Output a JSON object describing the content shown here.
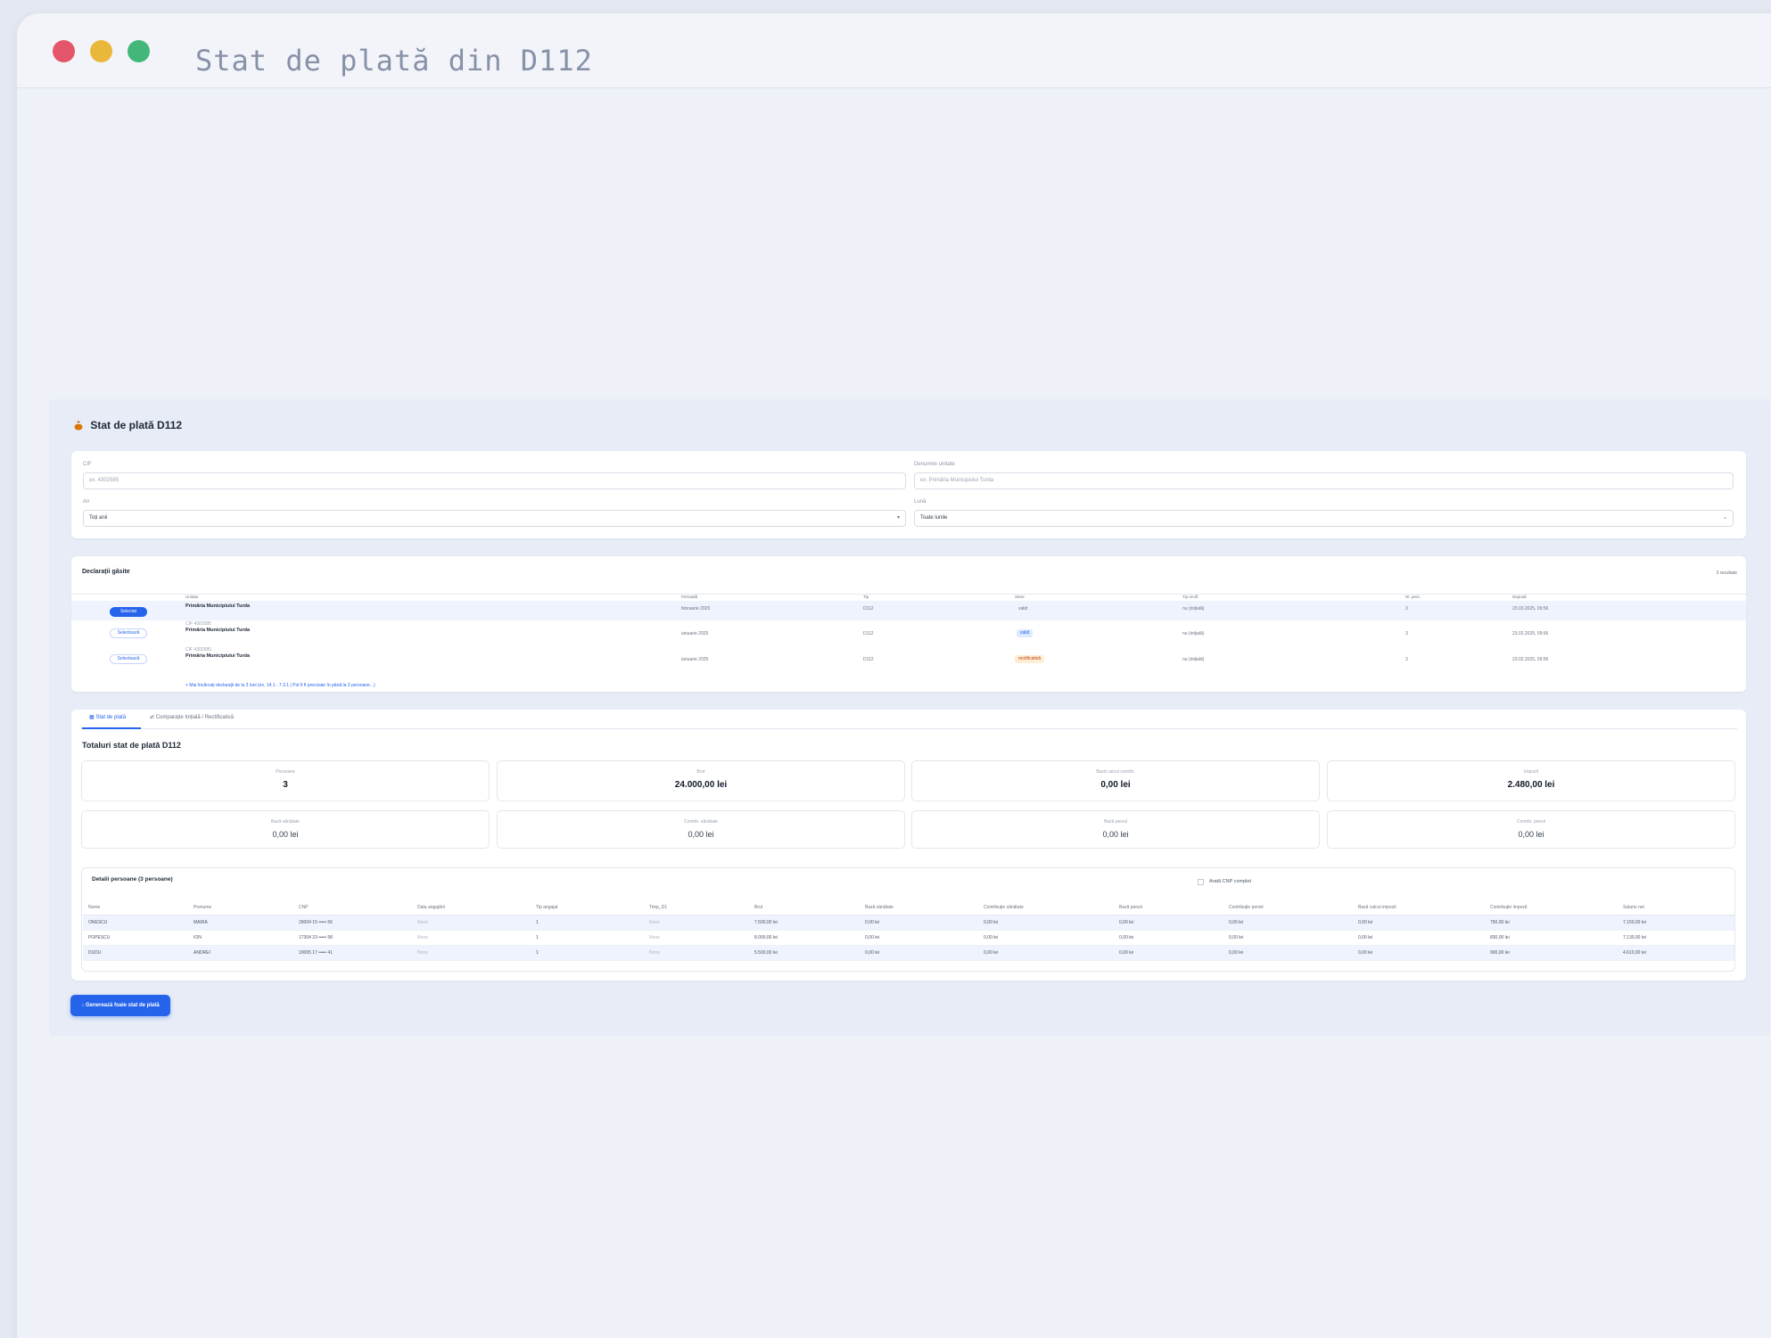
{
  "window": {
    "title": "Stat de plată din D112"
  },
  "app": {
    "title": "Stat de plată D112"
  },
  "filters": {
    "cif_label": "CIF",
    "cif_placeholder": "ex. 4302585",
    "denumire_label": "Denumire unitate",
    "denumire_placeholder": "ex. Primăria Municipiului Turda",
    "an_label": "An",
    "an_value": "Toți anii",
    "luna_label": "Lună",
    "luna_value": "Toate lunile"
  },
  "declaratii": {
    "title": "Declarații găsite",
    "count_text": "3 rezultate",
    "headers": [
      "Unitate",
      "Perioadă",
      "Tip",
      "Stare",
      "Tip rectif.",
      "Nr. pers.",
      "Depusă"
    ],
    "rows": [
      {
        "action": "Selectat",
        "cif": "",
        "unitate": "Primăria Municipiului Turda",
        "perioada": "februarie 2025",
        "tip": "D112",
        "stare": "valid",
        "rectif": "nu (inițială)",
        "nr": "3",
        "data": "23.03.2025, 09:56"
      },
      {
        "action": "Selectează",
        "cif": "CIF 4302585",
        "unitate": "Primăria Municipiului Turda",
        "perioada": "ianuarie 2025",
        "tip": "D112",
        "stare": "valid",
        "rectif": "nu (inițială)",
        "nr": "3",
        "data": "23.02.2025, 09:56"
      },
      {
        "action": "Selectează",
        "cif": "CIF 4302585",
        "unitate": "Primăria Municipiului Turda",
        "perioada": "ianuarie 2025",
        "tip": "D112",
        "stare": "rectificativă",
        "rectif": "nu (inițială)",
        "nr": "3",
        "data": "23.02.2025, 09:56"
      }
    ],
    "more_link": "+ Mai încărcați declarații de la 3 luni (ex. 14.1 - 7.3.1 | Pot fi fi precizate în până la 3 persoane...)"
  },
  "tabs": [
    "Stat de plată",
    "Comparație Inițială / Rectificativă"
  ],
  "totals": {
    "title": "Totaluri stat de plată D112",
    "primary": [
      {
        "label": "Persoane",
        "value": "3"
      },
      {
        "label": "Brut",
        "value": "24.000,00 lei"
      },
      {
        "label": "Bază calcul contrib.",
        "value": "0,00 lei"
      },
      {
        "label": "Impozit",
        "value": "2.480,00 lei"
      }
    ],
    "secondary": [
      {
        "label": "Bază sănătate",
        "value": "0,00 lei"
      },
      {
        "label": "Contrib. sănătate",
        "value": "0,00 lei"
      },
      {
        "label": "Bază pensii",
        "value": "0,00 lei"
      },
      {
        "label": "Contrib. pensii",
        "value": "0,00 lei"
      }
    ]
  },
  "persons": {
    "title": "Detalii persoane (3 persoane)",
    "checkbox_label": "Arată CNP complet",
    "headers": [
      "Nume",
      "Prenume",
      "CNP",
      "Data angajării",
      "Tip angajat",
      "Timp_D1",
      "Brut",
      "Bază sănătate",
      "Contribuție sănătate",
      "Bază pensii",
      "Contribuție pensii",
      "Bază calcul impozit",
      "Contribuție impozit",
      "Salariu net"
    ],
    "rows": [
      [
        "ONESCU",
        "MARIA",
        "29004 15 ••••• 56",
        "None",
        "1",
        "None",
        "7.500,00 lei",
        "0,00 lei",
        "0,00 lei",
        "0,00 lei",
        "0,00 lei",
        "0,00 lei",
        "750,00 lei",
        "7.150,00 lei"
      ],
      [
        "POPESCU",
        "ION",
        "17304 23 ••••• 58",
        "None",
        "1",
        "None",
        "8.000,00 lei",
        "0,00 lei",
        "0,00 lei",
        "0,00 lei",
        "0,00 lei",
        "0,00 lei",
        "830,00 lei",
        "7.130,00 lei"
      ],
      [
        "DUDU",
        "ANDREI",
        "19005 17 ••••• 41",
        "None",
        "1",
        "None",
        "5.500,00 lei",
        "0,00 lei",
        "0,00 lei",
        "0,00 lei",
        "0,00 lei",
        "0,00 lei",
        "900,00 lei",
        "4.610,00 lei"
      ]
    ]
  },
  "actions": {
    "generate_label": "↓ Generează foaie stat de plată"
  }
}
